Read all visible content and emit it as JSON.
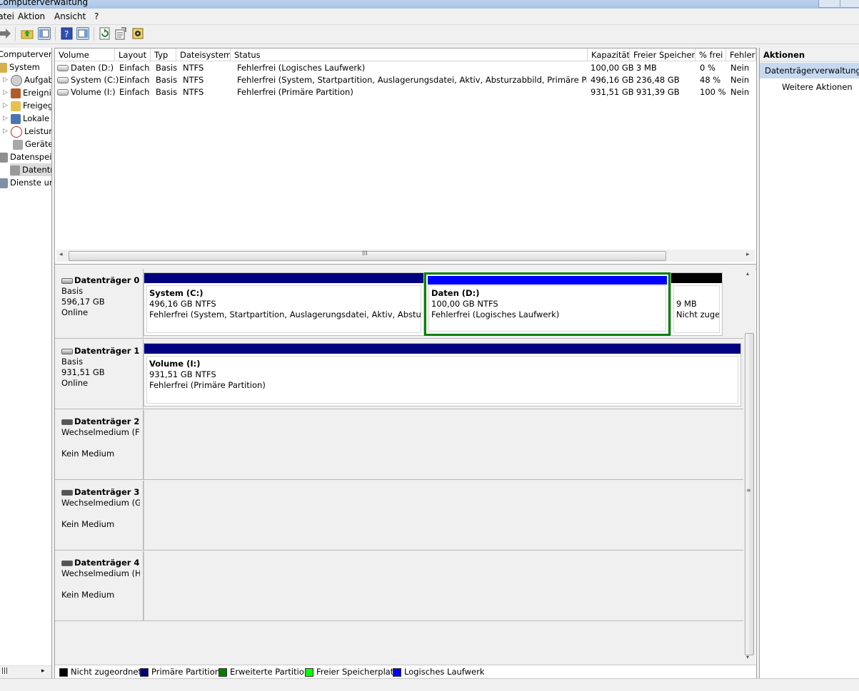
{
  "window": {
    "title": "Computerverwaltung"
  },
  "menu": [
    "Datei",
    "Aktion",
    "Ansicht",
    "?"
  ],
  "tree": [
    {
      "label": "Computerverwaltung"
    },
    {
      "label": "System"
    },
    {
      "label": "Aufgabenplanung"
    },
    {
      "label": "Ereignisanzeige"
    },
    {
      "label": "Freigegebene Ordner"
    },
    {
      "label": "Lokale Benutzer und Gruppen"
    },
    {
      "label": "Leistung"
    },
    {
      "label": "Geräte-Manager"
    },
    {
      "label": "Datenspeicher"
    },
    {
      "label": "Datenträgerverwaltung"
    },
    {
      "label": "Dienste und Anwendungen"
    }
  ],
  "volumes": {
    "columns": [
      "Volume",
      "Layout",
      "Typ",
      "Dateisystem",
      "Status",
      "Kapazität",
      "Freier Speicher",
      "% frei",
      "Fehlertoleranz"
    ],
    "rows": [
      [
        "Daten (D:)",
        "Einfach",
        "Basis",
        "NTFS",
        "Fehlerfrei (Logisches Laufwerk)",
        "100,00 GB",
        "3 MB",
        "0 %",
        "Nein"
      ],
      [
        "System (C:)",
        "Einfach",
        "Basis",
        "NTFS",
        "Fehlerfrei (System, Startpartition, Auslagerungsdatei, Aktiv, Absturzabbild, Primäre Partition)",
        "496,16 GB",
        "236,48 GB",
        "48 %",
        "Nein"
      ],
      [
        "Volume (I:)",
        "Einfach",
        "Basis",
        "NTFS",
        "Fehlerfrei (Primäre Partition)",
        "931,51 GB",
        "931,39 GB",
        "100 %",
        "Nein"
      ]
    ],
    "scroll_grip": "III"
  },
  "disks": [
    {
      "name": "Datenträger 0",
      "type": "Basis",
      "size": "596,17 GB",
      "state": "Online"
    },
    {
      "name": "Datenträger 1",
      "type": "Basis",
      "size": "931,51 GB",
      "state": "Online"
    },
    {
      "name": "Datenträger 2",
      "type": "Wechselmedium (F:)",
      "state": "Kein Medium"
    },
    {
      "name": "Datenträger 3",
      "type": "Wechselmedium (G:)",
      "state": "Kein Medium"
    },
    {
      "name": "Datenträger 4",
      "type": "Wechselmedium (H:)",
      "state": "Kein Medium"
    }
  ],
  "partitions": {
    "c": {
      "name": "System  (C:)",
      "size": "496,16 GB NTFS",
      "status": "Fehlerfrei (System, Startpartition, Auslagerungsdatei, Aktiv, Absturzabbild, Primäre Partition)"
    },
    "d": {
      "name": "Daten  (D:)",
      "size": "100,00 GB NTFS",
      "status": "Fehlerfrei (Logisches Laufwerk)"
    },
    "unalloc": {
      "size": "9 MB",
      "status": "Nicht zugeordnet"
    },
    "i": {
      "name": "Volume  (I:)",
      "size": "931,51 GB NTFS",
      "status": "Fehlerfrei (Primäre Partition)"
    }
  },
  "legend": [
    {
      "label": "Nicht zugeordnet",
      "color": "#000000"
    },
    {
      "label": "Primäre Partition",
      "color": "#000080"
    },
    {
      "label": "Erweiterte Partition",
      "color": "#008000"
    },
    {
      "label": "Freier Speicherplatz",
      "color": "#00ff00"
    },
    {
      "label": "Logisches Laufwerk",
      "color": "#0000ff"
    }
  ],
  "actions": {
    "title": "Aktionen",
    "section": "Datenträgerverwaltung",
    "more": "Weitere Aktionen"
  }
}
